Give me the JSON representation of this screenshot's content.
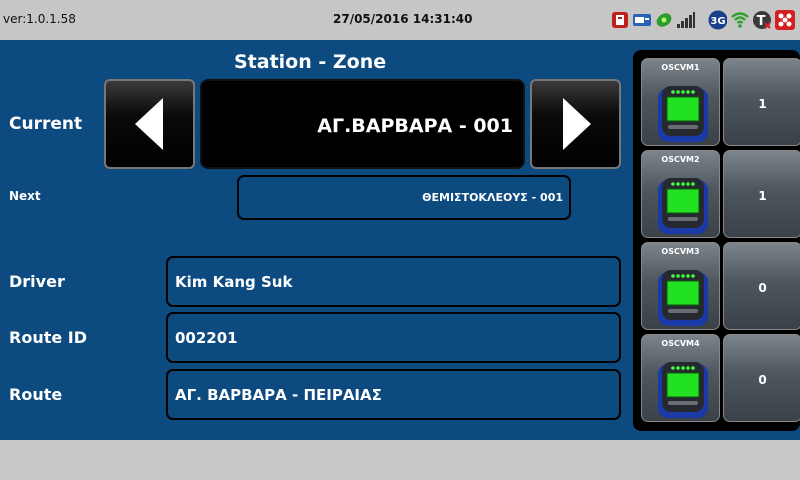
{
  "status_bar": {
    "version": "ver:1.0.1.58",
    "datetime": "27/05/2016 14:31:40",
    "icons": [
      "red-device-icon",
      "card-reader-icon",
      "green-gps-icon",
      "signal-bars-icon",
      "3g-icon",
      "wifi-icon",
      "t-disabled-icon",
      "network-red-icon"
    ],
    "network_label": "3G",
    "t_label": "T"
  },
  "main": {
    "title": "Station - Zone",
    "current_label": "Current",
    "current_station": "ΑΓ.ΒΑΡΒΑΡΑ  -  001",
    "next_label": "Next",
    "next_station": "ΘΕΜΙΣΤΟΚΛΕΟΥΣ  -  001",
    "driver_label": "Driver",
    "driver_value": "Kim Kang Suk",
    "route_id_label": "Route ID",
    "route_id_value": "002201",
    "route_label": "Route",
    "route_value": "ΑΓ. ΒΑΡΒΑΡΑ - ΠΕΙΡΑΙΑΣ"
  },
  "validators": [
    {
      "name": "OSCVM1",
      "count": "1"
    },
    {
      "name": "OSCVM2",
      "count": "1"
    },
    {
      "name": "OSCVM3",
      "count": "0"
    },
    {
      "name": "OSCVM4",
      "count": "0"
    }
  ],
  "colors": {
    "main_bg": "#0d4a80",
    "status_bg": "#c6c6c6",
    "screen_green": "#22e022"
  }
}
